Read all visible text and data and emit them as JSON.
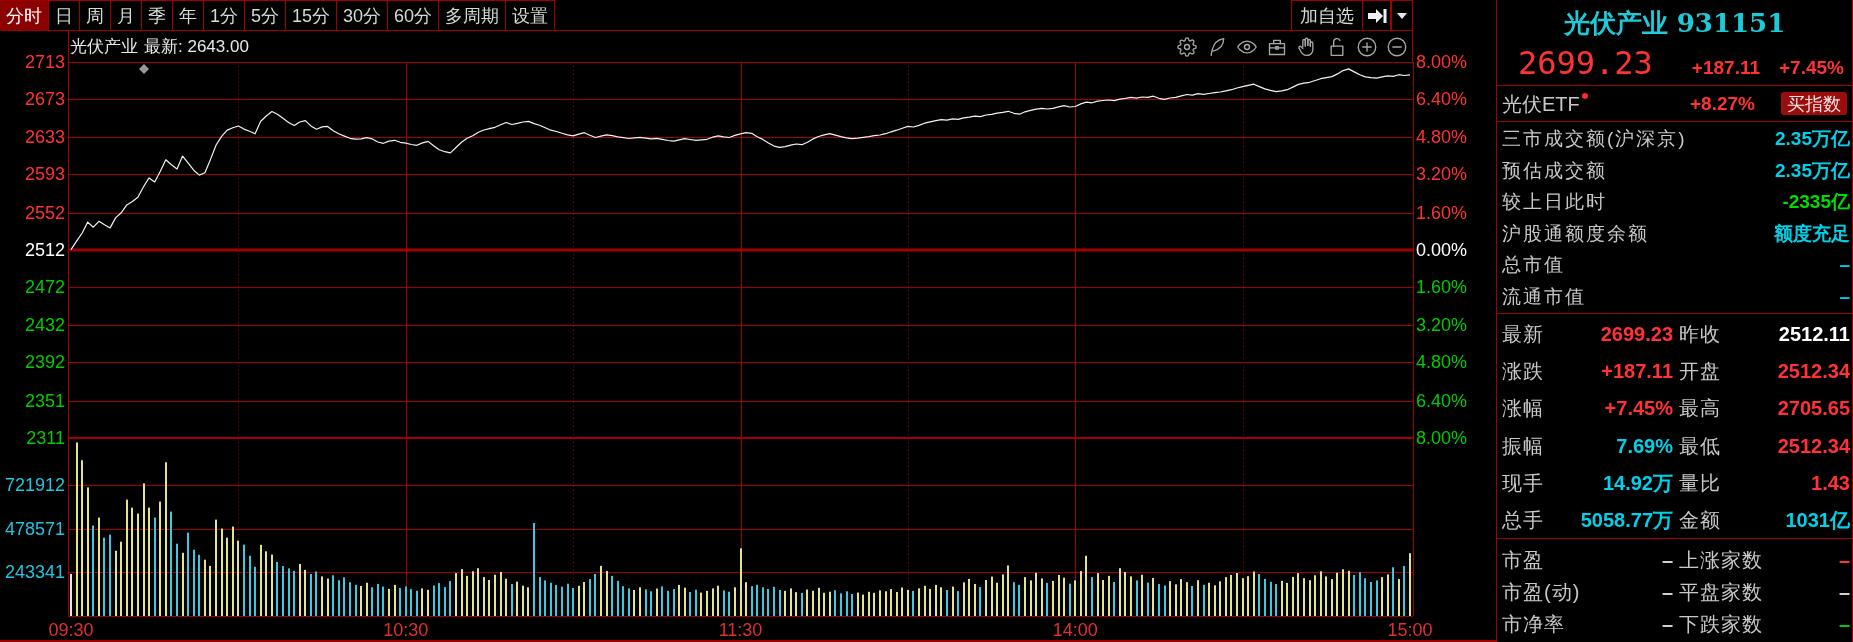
{
  "toolbar": {
    "tabs": [
      {
        "label": "分时",
        "selected": true
      },
      {
        "label": "日",
        "selected": false
      },
      {
        "label": "周",
        "selected": false
      },
      {
        "label": "月",
        "selected": false
      },
      {
        "label": "季",
        "selected": false
      },
      {
        "label": "年",
        "selected": false
      },
      {
        "label": "1分",
        "selected": false
      },
      {
        "label": "5分",
        "selected": false
      },
      {
        "label": "15分",
        "selected": false
      },
      {
        "label": "30分",
        "selected": false
      },
      {
        "label": "60分",
        "selected": false
      },
      {
        "label": "多周期",
        "selected": false
      },
      {
        "label": "设置",
        "selected": false
      }
    ],
    "add_button": "加自选"
  },
  "chart_header": {
    "name": "光伏产业",
    "latest": "最新: 2643.00"
  },
  "price_chart": {
    "chart_data": {
      "type": "line",
      "categories": [
        null,
        null,
        null,
        null,
        null,
        null,
        null,
        null,
        null,
        null,
        null,
        null,
        null,
        null,
        null,
        null,
        null,
        null,
        null,
        null,
        null,
        null,
        null,
        null,
        null,
        null,
        null,
        null,
        null,
        null,
        null,
        null,
        null,
        null,
        null,
        null,
        null,
        null,
        null,
        null,
        null,
        null,
        null,
        null,
        null,
        null,
        null,
        null,
        null,
        null,
        null,
        null,
        null,
        null,
        null,
        null,
        null,
        null,
        null,
        null,
        null,
        null,
        null,
        null,
        null,
        null,
        null,
        null,
        null,
        null,
        null,
        null,
        null,
        null,
        null,
        null,
        null,
        null,
        null,
        null,
        null,
        null,
        null,
        null,
        null,
        null,
        null,
        null,
        null,
        null,
        null,
        null,
        null,
        null,
        null,
        null,
        null,
        null,
        null,
        null,
        null,
        null,
        null,
        null,
        null,
        null,
        null,
        null,
        null,
        null,
        null,
        null,
        null,
        null,
        null,
        null,
        null,
        null,
        null,
        null,
        null,
        null,
        null,
        null,
        null,
        null,
        null,
        null,
        null,
        null,
        null,
        null,
        null,
        null,
        null,
        null,
        null,
        null,
        null,
        null,
        null,
        null,
        null,
        null,
        null,
        null,
        null,
        null,
        null,
        null,
        null,
        null,
        null,
        null,
        null,
        null,
        null,
        null,
        null,
        null,
        null,
        null,
        null,
        null,
        null,
        null,
        null,
        null,
        null,
        null,
        null,
        null,
        null,
        null,
        null,
        null,
        null,
        null,
        null,
        null,
        null,
        null,
        null,
        null,
        null,
        null,
        null,
        null,
        null,
        null,
        null,
        null,
        null,
        null,
        null,
        null,
        null,
        null,
        null,
        null,
        null,
        null,
        null,
        null,
        null,
        null,
        null,
        null,
        null,
        null,
        null,
        null,
        null,
        null,
        null,
        null,
        null,
        null,
        null,
        null,
        null,
        null,
        null,
        null,
        null,
        null,
        null,
        null,
        null,
        null,
        null,
        null,
        null,
        null,
        null,
        null,
        null,
        null,
        null,
        null,
        null
      ],
      "values": [
        2512.34,
        2521.5,
        2530.2,
        2541.8,
        2536.4,
        2542.7,
        2539.1,
        2535.6,
        2546.3,
        2551.8,
        2560.2,
        2563.9,
        2568.4,
        2579.6,
        2589.1,
        2584.7,
        2596.3,
        2608.5,
        2603.2,
        2598.7,
        2612.4,
        2604.8,
        2597.3,
        2592.1,
        2594.6,
        2608.9,
        2624.3,
        2633.5,
        2640.2,
        2642.8,
        2644.6,
        2641.3,
        2638.9,
        2636.2,
        2649.7,
        2655.3,
        2660.1,
        2657.2,
        2652.8,
        2648.4,
        2645.1,
        2648.9,
        2650.3,
        2644.7,
        2641.2,
        2643.6,
        2644.1,
        2639.5,
        2636.2,
        2633.8,
        2631.4,
        2630.6,
        2630.9,
        2632.2,
        2630.8,
        2627.5,
        2626.1,
        2628.4,
        2629.3,
        2627.1,
        2626.2,
        2624.8,
        2623.9,
        2626.5,
        2628.1,
        2623.4,
        2619.2,
        2617.1,
        2615.8,
        2621.6,
        2627.3,
        2631.4,
        2634.2,
        2637.9,
        2640.3,
        2641.8,
        2643.2,
        2645.9,
        2648.3,
        2646.2,
        2647.4,
        2648.8,
        2649.5,
        2647.1,
        2645.3,
        2642.6,
        2640.1,
        2638.7,
        2636.9,
        2635.2,
        2634.1,
        2635.8,
        2637.4,
        2634.6,
        2632.3,
        2633.7,
        2635.1,
        2634.2,
        2633.0,
        2632.1,
        2631.2,
        2631.9,
        2632.4,
        2631.6,
        2630.9,
        2631.3,
        2630.2,
        2629.1,
        2628.4,
        2629.7,
        2631.0,
        2630.1,
        2629.2,
        2629.8,
        2630.4,
        2632.6,
        2634.1,
        2633.0,
        2632.3,
        2634.5,
        2636.2,
        2637.4,
        2636.8,
        2633.1,
        2630.2,
        2626.4,
        2623.1,
        2621.8,
        2622.4,
        2624.1,
        2625.3,
        2624.6,
        2627.2,
        2630.8,
        2633.4,
        2635.1,
        2636.3,
        2634.8,
        2633.2,
        2631.9,
        2631.1,
        2631.6,
        2632.4,
        2633.1,
        2634.2,
        2635.0,
        2636.3,
        2638.4,
        2640.1,
        2642.2,
        2644.1,
        2643.5,
        2645.2,
        2647.6,
        2649.1,
        2650.3,
        2651.4,
        2650.8,
        2652.2,
        2651.6,
        2653.3,
        2654.1,
        2655.2,
        2654.6,
        2656.3,
        2657.1,
        2658.4,
        2659.2,
        2660.3,
        2658.1,
        2657.2,
        2659.8,
        2661.3,
        2662.6,
        2663.4,
        2662.7,
        2663.5,
        2665.1,
        2666.3,
        2664.9,
        2665.4,
        2668.2,
        2670.1,
        2669.4,
        2671.2,
        2671.8,
        2672.4,
        2671.6,
        2673.3,
        2674.1,
        2675.2,
        2674.3,
        2675.6,
        2675.1,
        2676.4,
        2674.2,
        2673.1,
        2674.5,
        2675.3,
        2676.8,
        2678.2,
        2677.6,
        2679.1,
        2678.4,
        2679.3,
        2680.2,
        2680.9,
        2682.1,
        2683.4,
        2685.2,
        2686.6,
        2688.1,
        2689.3,
        2686.7,
        2684.2,
        2682.6,
        2681.3,
        2682.1,
        2683.4,
        2686.2,
        2689.1,
        2690.4,
        2691.3,
        2693.2,
        2695.1,
        2696.2,
        2697.4,
        2700.3,
        2703.8,
        2705.6,
        2702.4,
        2699.3,
        2697.1,
        2696.2,
        2695.8,
        2697.2,
        2698.1,
        2697.6,
        2699.4,
        2698.6,
        2699.2
      ],
      "ylim": [
        2311,
        2713
      ],
      "yticks": [
        2713,
        2673,
        2633,
        2593,
        2552,
        2512,
        2472,
        2432,
        2392,
        2351,
        2311
      ],
      "grid": true,
      "ref_lines": [
        {
          "axis": "y",
          "value": 2512.11
        }
      ]
    },
    "percent_labels": [
      "8.00%",
      "6.40%",
      "4.80%",
      "3.20%",
      "1.60%",
      "0.00%",
      "1.60%",
      "3.20%",
      "4.80%",
      "6.40%",
      "8.00%"
    ]
  },
  "volume_chart": {
    "chart_data": {
      "type": "bar",
      "categories": [
        "09:30",
        null,
        null,
        null,
        null,
        null,
        null,
        null,
        null,
        null,
        null,
        null,
        null,
        null,
        null,
        null,
        null,
        null,
        null,
        null,
        null,
        null,
        null,
        null,
        null,
        null,
        null,
        null,
        null,
        null,
        null,
        null,
        null,
        null,
        null,
        null,
        null,
        null,
        null,
        null,
        null,
        null,
        null,
        null,
        null,
        null,
        null,
        null,
        null,
        null,
        null,
        null,
        null,
        null,
        null,
        null,
        null,
        null,
        null,
        null,
        "10:30",
        null,
        null,
        null,
        null,
        null,
        null,
        null,
        null,
        null,
        null,
        null,
        null,
        null,
        null,
        null,
        null,
        null,
        null,
        null,
        null,
        null,
        null,
        null,
        null,
        null,
        null,
        null,
        null,
        null,
        null,
        null,
        null,
        null,
        null,
        null,
        null,
        null,
        null,
        null,
        null,
        null,
        null,
        null,
        null,
        null,
        null,
        null,
        null,
        null,
        null,
        null,
        null,
        null,
        null,
        null,
        null,
        null,
        null,
        null,
        "11:30",
        null,
        null,
        null,
        null,
        null,
        null,
        null,
        null,
        null,
        null,
        null,
        null,
        null,
        null,
        null,
        null,
        null,
        null,
        null,
        null,
        null,
        null,
        null,
        null,
        null,
        null,
        null,
        null,
        null,
        null,
        null,
        null,
        null,
        null,
        null,
        null,
        null,
        null,
        null,
        null,
        null,
        null,
        null,
        null,
        null,
        null,
        null,
        null,
        null,
        null,
        null,
        null,
        null,
        null,
        null,
        null,
        null,
        null,
        null,
        "14:00",
        null,
        null,
        null,
        null,
        null,
        null,
        null,
        null,
        null,
        null,
        null,
        null,
        null,
        null,
        null,
        null,
        null,
        null,
        null,
        null,
        null,
        null,
        null,
        null,
        null,
        null,
        null,
        null,
        null,
        null,
        null,
        null,
        null,
        null,
        null,
        null,
        null,
        null,
        null,
        null,
        null,
        null,
        null,
        null,
        null,
        null,
        null,
        null,
        null,
        null,
        null,
        null,
        null,
        null,
        null,
        null,
        null,
        null,
        null,
        "15:00"
      ],
      "values": [
        232000,
        955000,
        857000,
        708000,
        498000,
        542000,
        431000,
        448000,
        359000,
        409000,
        641000,
        597000,
        564000,
        730000,
        597000,
        542000,
        630000,
        846000,
        575000,
        398000,
        348000,
        459000,
        365000,
        337000,
        310000,
        276000,
        531000,
        481000,
        431000,
        492000,
        415000,
        393000,
        332000,
        271000,
        392000,
        356000,
        338000,
        298000,
        275000,
        262000,
        248000,
        287000,
        254000,
        231000,
        245000,
        218000,
        206000,
        224000,
        197000,
        213000,
        186000,
        172000,
        165000,
        183000,
        158000,
        176000,
        162000,
        149000,
        171000,
        154000,
        163000,
        148000,
        139000,
        152000,
        144000,
        168000,
        181000,
        159000,
        192000,
        236000,
        258000,
        221000,
        246000,
        263000,
        214000,
        198000,
        227000,
        242000,
        205000,
        176000,
        189000,
        167000,
        158000,
        512000,
        214000,
        196000,
        183000,
        171000,
        162000,
        178000,
        154000,
        166000,
        187000,
        203000,
        232000,
        276000,
        248000,
        221000,
        193000,
        164000,
        152000,
        143000,
        158000,
        147000,
        136000,
        151000,
        163000,
        139000,
        148000,
        171000,
        156000,
        132000,
        145000,
        129000,
        138000,
        152000,
        167000,
        141000,
        134000,
        158000,
        372000,
        186000,
        164000,
        172000,
        158000,
        149000,
        161000,
        143000,
        138000,
        152000,
        131000,
        127000,
        146000,
        139000,
        155000,
        128000,
        134000,
        142000,
        125000,
        136000,
        121000,
        129000,
        118000,
        133000,
        127000,
        141000,
        136000,
        148000,
        132000,
        157000,
        144000,
        138000,
        152000,
        166000,
        149000,
        171000,
        158000,
        143000,
        162000,
        137000,
        185000,
        204000,
        176000,
        159000,
        198000,
        217000,
        183000,
        229000,
        278000,
        186000,
        171000,
        214000,
        196000,
        238000,
        207000,
        182000,
        193000,
        226000,
        211000,
        178000,
        196000,
        247000,
        332000,
        214000,
        236000,
        198000,
        221000,
        187000,
        263000,
        242000,
        218000,
        196000,
        227000,
        184000,
        209000,
        176000,
        168000,
        192000,
        174000,
        203000,
        186000,
        165000,
        197000,
        172000,
        183000,
        169000,
        191000,
        214000,
        226000,
        237000,
        208000,
        219000,
        245000,
        231000,
        204000,
        188000,
        176000,
        193000,
        182000,
        215000,
        236000,
        208000,
        197000,
        224000,
        246000,
        218000,
        203000,
        238000,
        257000,
        249000,
        226000,
        241000,
        208000,
        187000,
        196000,
        214000,
        229000,
        268000,
        203000,
        275000,
        346000
      ],
      "ylim": [
        0,
        980000
      ],
      "yticks": [
        243341,
        478571,
        721912
      ],
      "grid": true
    }
  },
  "quote_panel": {
    "title": "光伏产业 931151",
    "price": "2699.23",
    "change": "+187.11",
    "change_pct": "+7.45%",
    "etf": {
      "name": "光伏ETF",
      "alert": true,
      "change": "+8.27%",
      "button": "买指数"
    },
    "market_stats": [
      {
        "label": "三市成交额(沪深京)",
        "value": "2.35万亿",
        "color": "#00d0e8"
      },
      {
        "label": "预估成交额",
        "value": "2.35万亿",
        "color": "#00d0e8"
      },
      {
        "label": "较上日此时",
        "value": "-2335亿",
        "color": "#00dd00"
      },
      {
        "label": "沪股通额度余额",
        "value": "额度充足",
        "color": "#00d0e8"
      },
      {
        "label": "总市值",
        "value": "–",
        "color": "#00d0e8"
      },
      {
        "label": "流通市值",
        "value": "–",
        "color": "#00d0e8"
      }
    ],
    "quotes": [
      {
        "label": "最新",
        "value": "2699.23",
        "color": "#ff3333"
      },
      {
        "label": "昨收",
        "value": "2512.11",
        "color": "#ffffff"
      },
      {
        "label": "涨跌",
        "value": "+187.11",
        "color": "#ff3333"
      },
      {
        "label": "开盘",
        "value": "2512.34",
        "color": "#ff3333"
      },
      {
        "label": "涨幅",
        "value": "+7.45%",
        "color": "#ff3333"
      },
      {
        "label": "最高",
        "value": "2705.65",
        "color": "#ff3333"
      },
      {
        "label": "振幅",
        "value": "7.69%",
        "color": "#00d0e8"
      },
      {
        "label": "最低",
        "value": "2512.34",
        "color": "#ff3333"
      },
      {
        "label": "现手",
        "value": "14.92万",
        "color": "#00d0e8"
      },
      {
        "label": "量比",
        "value": "1.43",
        "color": "#ff3333"
      },
      {
        "label": "总手",
        "value": "5058.77万",
        "color": "#00d0e8"
      },
      {
        "label": "金额",
        "value": "1031亿",
        "color": "#00d0e8"
      }
    ],
    "valuation": {
      "left_column": [
        {
          "label": "市盈",
          "value": "–",
          "color": "#d0d0d0"
        },
        {
          "label": "市盈(动)",
          "value": "–",
          "color": "#d0d0d0"
        },
        {
          "label": "市净率",
          "value": "–",
          "color": "#d0d0d0"
        }
      ],
      "right_column": [
        {
          "label": "上涨家数",
          "value": "–",
          "color": "#ff3333"
        },
        {
          "label": "平盘家数",
          "value": "–",
          "color": "#d0d0d0"
        },
        {
          "label": "下跌家数",
          "value": "–",
          "color": "#00cc00"
        }
      ]
    }
  }
}
